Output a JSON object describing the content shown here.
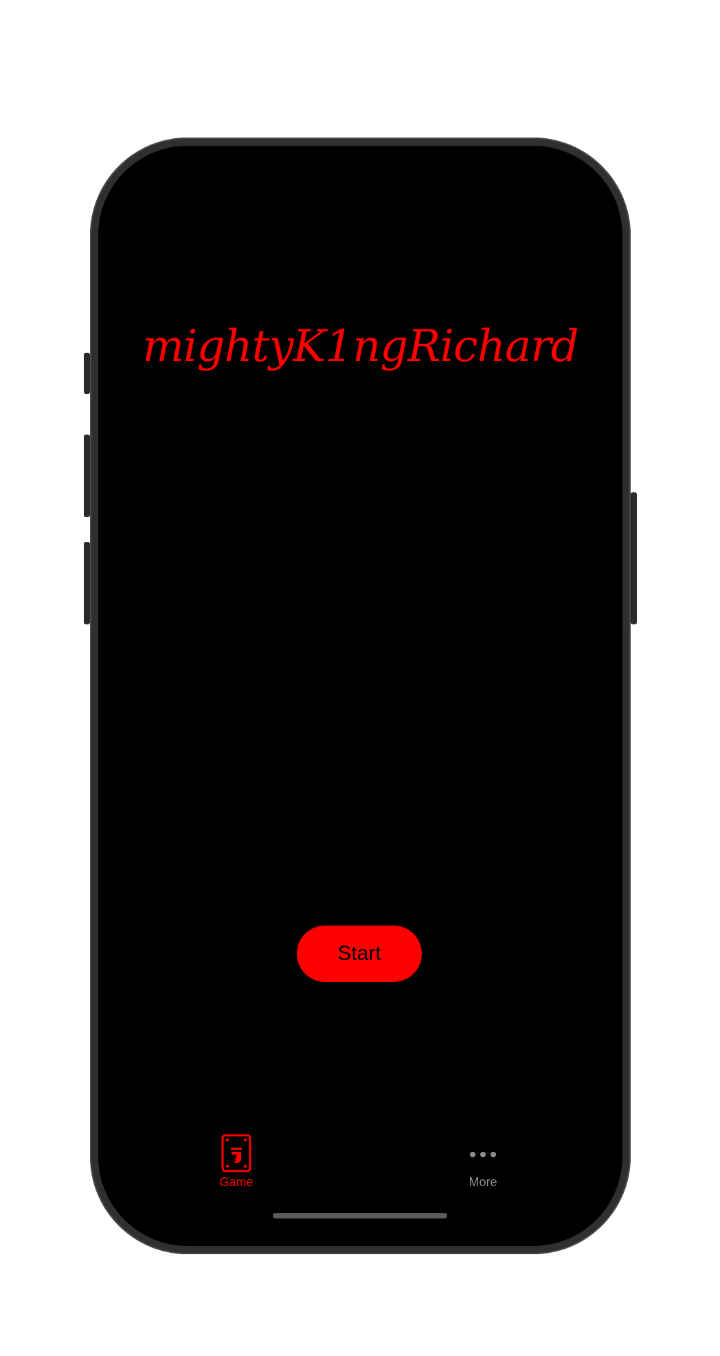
{
  "app": {
    "title": "mightyK1ngRichard"
  },
  "main": {
    "start_label": "Start"
  },
  "tabbar": {
    "items": [
      {
        "label": "Game",
        "icon": "game-card-icon",
        "selected": true
      },
      {
        "label": "More",
        "icon": "more-icon",
        "selected": false
      }
    ]
  },
  "colors": {
    "accent": "#ff0000",
    "background": "#000000",
    "inactive": "#8e8e93"
  }
}
